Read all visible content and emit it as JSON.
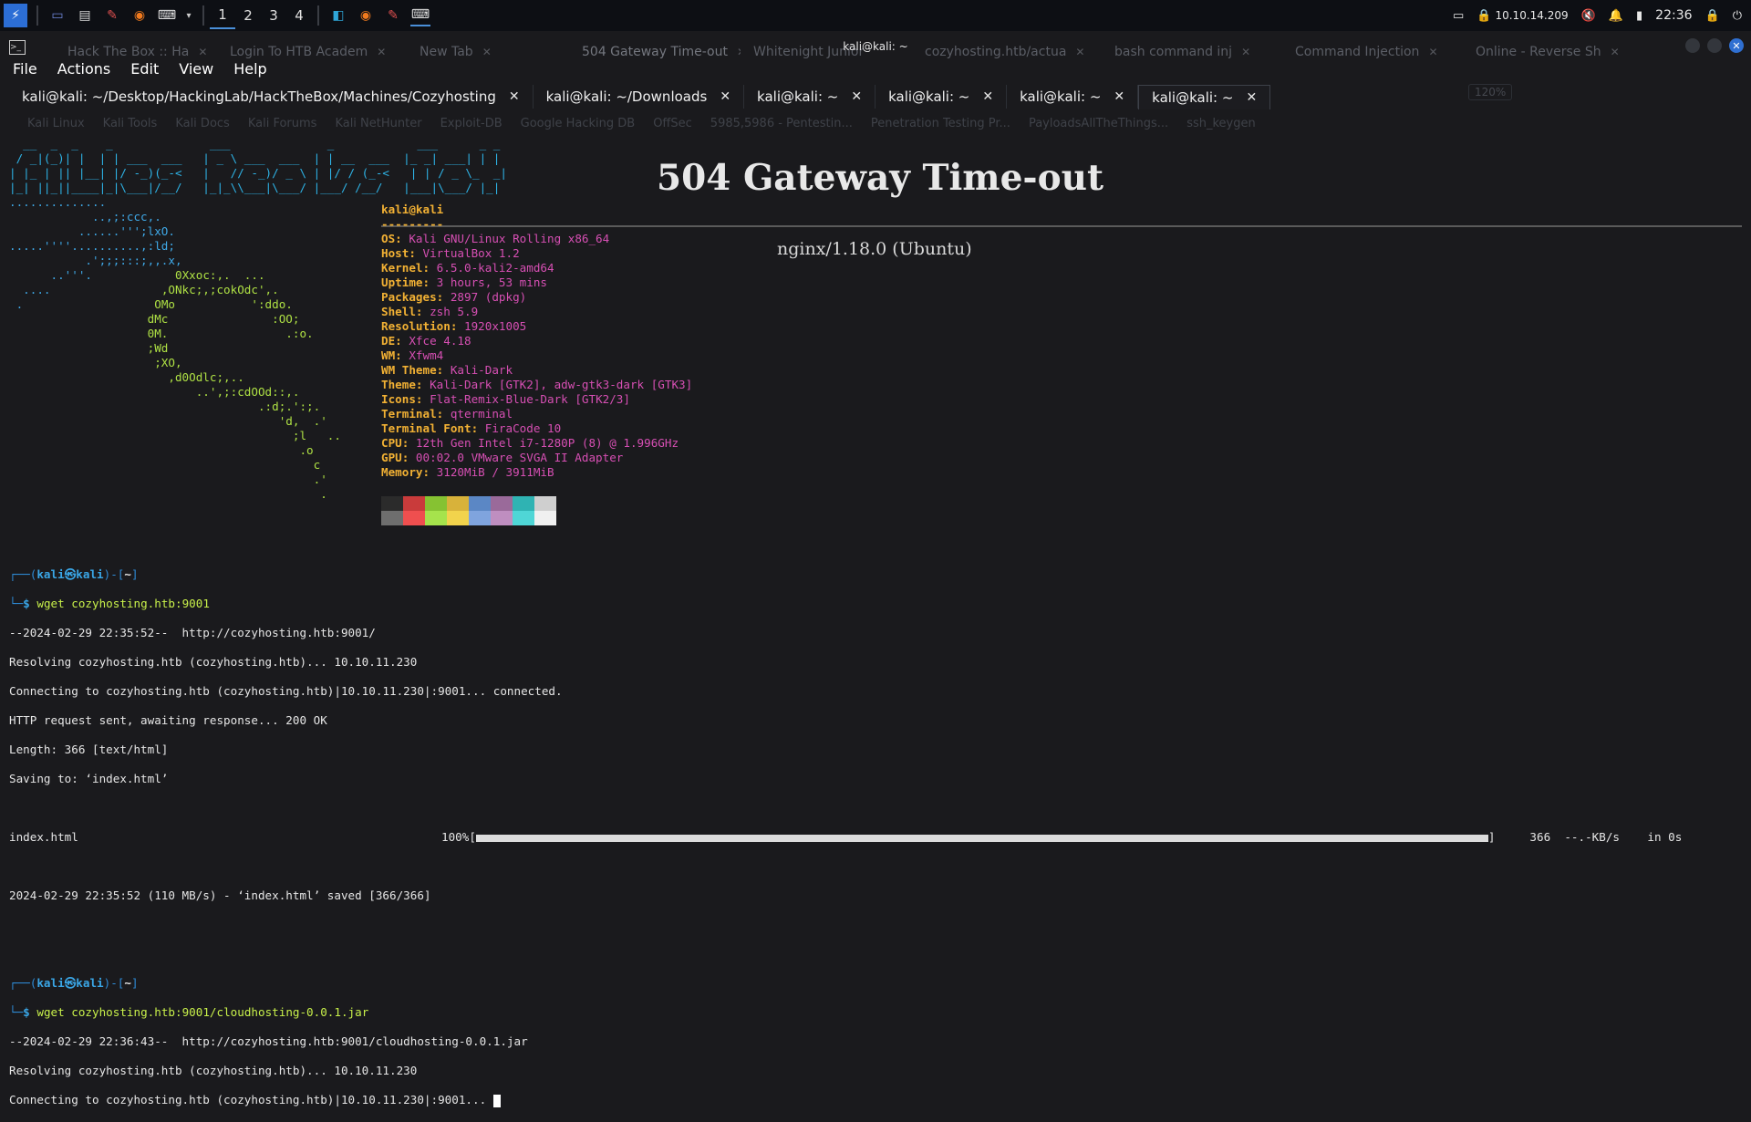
{
  "panel": {
    "workspaces": [
      "1",
      "2",
      "3",
      "4"
    ],
    "active_workspace": "1",
    "ip": "10.10.14.209",
    "clock": "22:36"
  },
  "firefox": {
    "tabs": [
      "Hack The Box :: Ha",
      "Login To HTB Academ",
      "New Tab",
      "504 Gateway Time-out",
      "Whitenight Junior",
      "cozyhosting.htb/actua",
      "bash command inj",
      "Command Injection",
      "Online - Reverse Sh"
    ],
    "zoom": "120%",
    "bookmarks": [
      "Kali Linux",
      "Kali Tools",
      "Kali Docs",
      "Kali Forums",
      "Kali NetHunter",
      "Exploit-DB",
      "Google Hacking DB",
      "OffSec",
      "5985,5986 - Pentestin...",
      "Penetration Testing Pr...",
      "PayloadsAllTheThings...",
      "ssh_keygen"
    ]
  },
  "terminal": {
    "window_title": "kali@kali: ~",
    "menu": [
      "File",
      "Actions",
      "Edit",
      "View",
      "Help"
    ],
    "tabs": [
      {
        "label": "kali@kali: ~/Desktop/HackingLab/HackTheBox/Machines/Cozyhosting",
        "active": false
      },
      {
        "label": "kali@kali: ~/Downloads",
        "active": false
      },
      {
        "label": "kali@kali: ~",
        "active": false
      },
      {
        "label": "kali@kali: ~",
        "active": false
      },
      {
        "label": "kali@kali: ~",
        "active": false
      },
      {
        "label": "kali@kali: ~",
        "active": true
      }
    ]
  },
  "browser_page": {
    "heading": "504 Gateway Time-out",
    "server": "nginx/1.18.0 (Ubuntu)"
  },
  "neofetch": {
    "header": "kali@kali",
    "underline": "---------",
    "fields": [
      {
        "k": "OS",
        "v": "Kali GNU/Linux Rolling x86_64"
      },
      {
        "k": "Host",
        "v": "VirtualBox 1.2"
      },
      {
        "k": "Kernel",
        "v": "6.5.0-kali2-amd64"
      },
      {
        "k": "Uptime",
        "v": "3 hours, 53 mins"
      },
      {
        "k": "Packages",
        "v": "2897 (dpkg)"
      },
      {
        "k": "Shell",
        "v": "zsh 5.9"
      },
      {
        "k": "Resolution",
        "v": "1920x1005"
      },
      {
        "k": "DE",
        "v": "Xfce 4.18"
      },
      {
        "k": "WM",
        "v": "Xfwm4"
      },
      {
        "k": "WM Theme",
        "v": "Kali-Dark"
      },
      {
        "k": "Theme",
        "v": "Kali-Dark [GTK2], adw-gtk3-dark [GTK3]"
      },
      {
        "k": "Icons",
        "v": "Flat-Remix-Blue-Dark [GTK2/3]"
      },
      {
        "k": "Terminal",
        "v": "qterminal"
      },
      {
        "k": "Terminal Font",
        "v": "FiraCode 10"
      },
      {
        "k": "CPU",
        "v": "12th Gen Intel i7-1280P (8) @ 1.996GHz"
      },
      {
        "k": "GPU",
        "v": "00:02.0 VMware SVGA II Adapter"
      },
      {
        "k": "Memory",
        "v": "3120MiB / 3911MiB"
      }
    ],
    "palette_top": [
      "#2b2b2b",
      "#c93b3b",
      "#86c232",
      "#d8b23a",
      "#5b87c5",
      "#9a6a9a",
      "#2fb3b3",
      "#cfcfcf"
    ],
    "palette_bottom": [
      "#6e6e6e",
      "#ef4f4f",
      "#a6e34c",
      "#f2d34c",
      "#7fa4de",
      "#bf8ec0",
      "#4fd6d6",
      "#f0f0f0"
    ]
  },
  "session": {
    "prompt_user": "kali",
    "prompt_host": "kali",
    "prompt_dir": "~",
    "cmd1": "wget cozyhosting.htb:9001",
    "out1": [
      "--2024-02-29 22:35:52--  http://cozyhosting.htb:9001/",
      "Resolving cozyhosting.htb (cozyhosting.htb)... 10.10.11.230",
      "Connecting to cozyhosting.htb (cozyhosting.htb)|10.10.11.230|:9001... connected.",
      "HTTP request sent, awaiting response... 200 OK",
      "Length: 366 [text/html]",
      "Saving to: ‘index.html’"
    ],
    "progress": {
      "file": "index.html",
      "percent_label": "100%[",
      "percent": 1.0,
      "size": "366",
      "rate": "--.-KB/s",
      "time": "in 0s"
    },
    "saved": "2024-02-29 22:35:52 (110 MB/s) - ‘index.html’ saved [366/366]",
    "cmd2": "wget cozyhosting.htb:9001/cloudhosting-0.0.1.jar",
    "out2": [
      "--2024-02-29 22:36:43--  http://cozyhosting.htb:9001/cloudhosting-0.0.1.jar",
      "Resolving cozyhosting.htb (cozyhosting.htb)... 10.10.11.230",
      "Connecting to cozyhosting.htb (cozyhosting.htb)|10.10.11.230|:9001... "
    ]
  }
}
